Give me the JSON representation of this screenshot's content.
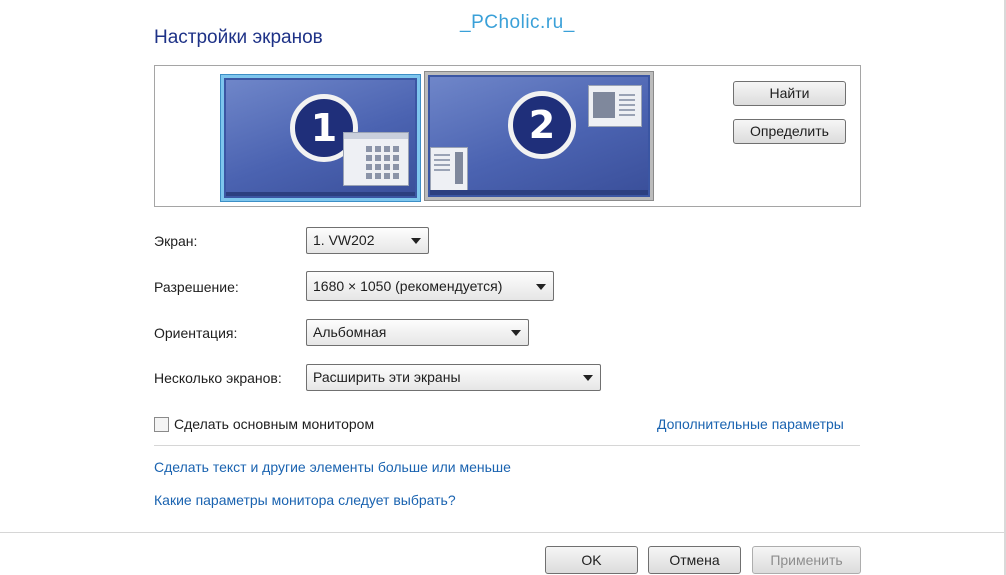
{
  "header": {
    "title": "Настройки экранов",
    "watermark": "_PCholic.ru_"
  },
  "preview": {
    "monitor1_number": "1",
    "monitor2_number": "2",
    "detect_button": "Найти",
    "identify_button": "Определить"
  },
  "settings": {
    "display_label": "Экран:",
    "display_value": "1. VW202",
    "resolution_label": "Разрешение:",
    "resolution_value": "1680 × 1050 (рекомендуется)",
    "orientation_label": "Ориентация:",
    "orientation_value": "Альбомная",
    "multiple_label": "Несколько экранов:",
    "multiple_value": "Расширить эти экраны"
  },
  "primary_checkbox": {
    "label": "Сделать основным монитором",
    "checked": false
  },
  "links": {
    "advanced": "Дополнительные параметры",
    "text_size": "Сделать текст и другие элементы больше или меньше",
    "which_settings": "Какие параметры монитора следует выбрать?"
  },
  "footer": {
    "ok": "OK",
    "cancel": "Отмена",
    "apply": "Применить"
  },
  "colors": {
    "link": "#1a63b0",
    "title": "#1e3287",
    "selected_monitor_border": "#7ec6ee"
  }
}
